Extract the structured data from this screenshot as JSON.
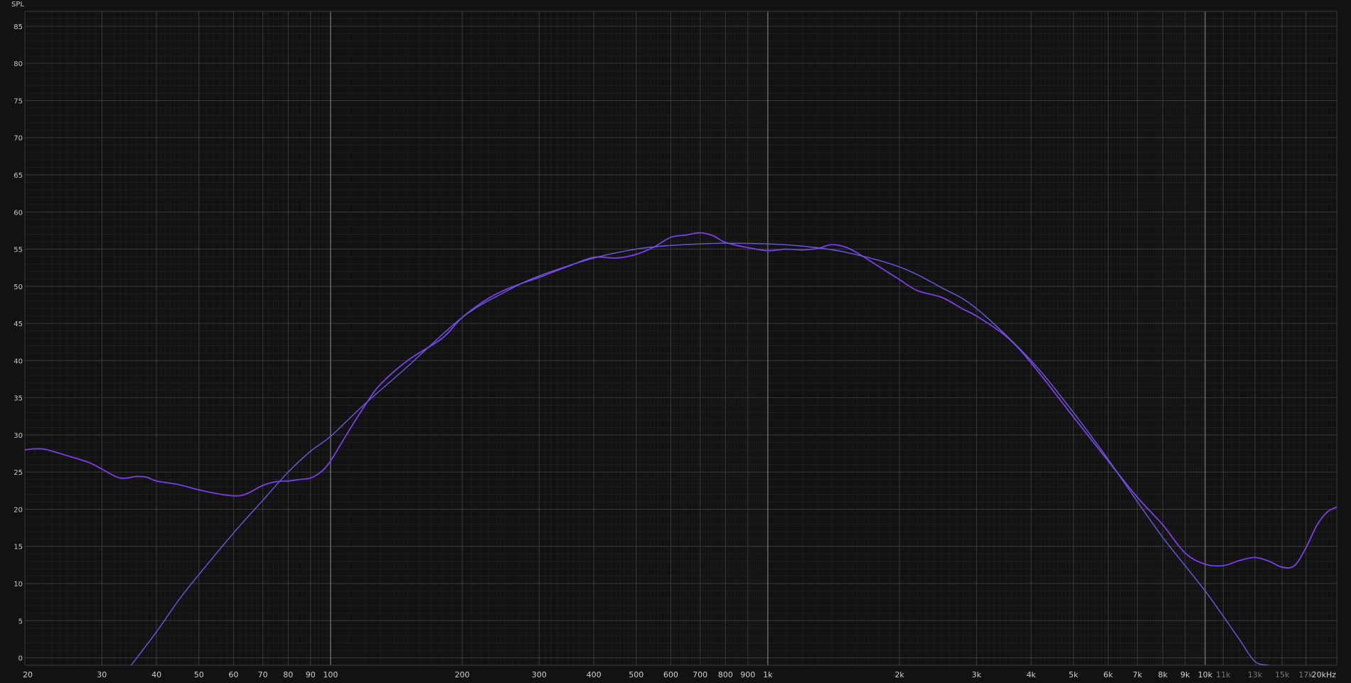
{
  "chart_data": {
    "type": "line",
    "title": "",
    "ylabel": "SPL",
    "xlabel": "",
    "x_scale": "log",
    "xlim": [
      20,
      20000
    ],
    "ylim": [
      -1,
      87
    ],
    "grid": true,
    "y_ticks": [
      {
        "value": 0,
        "label": "0"
      },
      {
        "value": 5,
        "label": "5"
      },
      {
        "value": 10,
        "label": "10"
      },
      {
        "value": 15,
        "label": "15"
      },
      {
        "value": 20,
        "label": "20"
      },
      {
        "value": 25,
        "label": "25"
      },
      {
        "value": 30,
        "label": "30"
      },
      {
        "value": 35,
        "label": "35"
      },
      {
        "value": 40,
        "label": "40"
      },
      {
        "value": 45,
        "label": "45"
      },
      {
        "value": 50,
        "label": "50"
      },
      {
        "value": 55,
        "label": "55"
      },
      {
        "value": 60,
        "label": "60"
      },
      {
        "value": 65,
        "label": "65"
      },
      {
        "value": 70,
        "label": "70"
      },
      {
        "value": 75,
        "label": "75"
      },
      {
        "value": 80,
        "label": "80"
      },
      {
        "value": 85,
        "label": "85"
      }
    ],
    "x_ticks": [
      {
        "value": 20,
        "label": "20",
        "minor": false
      },
      {
        "value": 30,
        "label": "30",
        "minor": false
      },
      {
        "value": 40,
        "label": "40",
        "minor": false
      },
      {
        "value": 50,
        "label": "50",
        "minor": false
      },
      {
        "value": 60,
        "label": "60",
        "minor": false
      },
      {
        "value": 70,
        "label": "70",
        "minor": false
      },
      {
        "value": 80,
        "label": "80",
        "minor": false
      },
      {
        "value": 90,
        "label": "90",
        "minor": false
      },
      {
        "value": 100,
        "label": "100",
        "minor": false
      },
      {
        "value": 200,
        "label": "200",
        "minor": false
      },
      {
        "value": 300,
        "label": "300",
        "minor": false
      },
      {
        "value": 400,
        "label": "400",
        "minor": false
      },
      {
        "value": 500,
        "label": "500",
        "minor": false
      },
      {
        "value": 600,
        "label": "600",
        "minor": false
      },
      {
        "value": 700,
        "label": "700",
        "minor": false
      },
      {
        "value": 800,
        "label": "800",
        "minor": false
      },
      {
        "value": 900,
        "label": "900",
        "minor": false
      },
      {
        "value": 1000,
        "label": "1k",
        "minor": false
      },
      {
        "value": 2000,
        "label": "2k",
        "minor": false
      },
      {
        "value": 3000,
        "label": "3k",
        "minor": false
      },
      {
        "value": 4000,
        "label": "4k",
        "minor": false
      },
      {
        "value": 5000,
        "label": "5k",
        "minor": false
      },
      {
        "value": 6000,
        "label": "6k",
        "minor": false
      },
      {
        "value": 7000,
        "label": "7k",
        "minor": false
      },
      {
        "value": 8000,
        "label": "8k",
        "minor": false
      },
      {
        "value": 9000,
        "label": "9k",
        "minor": false
      },
      {
        "value": 10000,
        "label": "10k",
        "minor": false
      },
      {
        "value": 11000,
        "label": "11k",
        "minor": true
      },
      {
        "value": 13000,
        "label": "13k",
        "minor": true
      },
      {
        "value": 15000,
        "label": "15k",
        "minor": true
      },
      {
        "value": 17000,
        "label": "17k",
        "minor": true
      },
      {
        "value": 20000,
        "label": "20kHz",
        "minor": false
      }
    ],
    "decade_lines": [
      100,
      1000,
      10000
    ],
    "series": [
      {
        "color": "#7b3fe8",
        "x": [
          20,
          22,
          25,
          28,
          30,
          33,
          36,
          38,
          40,
          45,
          50,
          55,
          60,
          63,
          66,
          70,
          75,
          80,
          85,
          90,
          95,
          100,
          110,
          120,
          130,
          150,
          180,
          200,
          230,
          260,
          300,
          350,
          400,
          450,
          500,
          550,
          600,
          650,
          700,
          750,
          800,
          900,
          1000,
          1100,
          1200,
          1300,
          1400,
          1500,
          1600,
          1800,
          2000,
          2200,
          2500,
          2800,
          3000,
          3500,
          4000,
          5000,
          6000,
          7000,
          8000,
          9000,
          10000,
          11000,
          12000,
          13000,
          14000,
          15000,
          16000,
          17000,
          18000,
          19000,
          20000
        ],
        "y": [
          28.0,
          28.1,
          27.2,
          26.3,
          25.4,
          24.2,
          24.4,
          24.3,
          23.8,
          23.3,
          22.6,
          22.1,
          21.8,
          21.9,
          22.4,
          23.2,
          23.7,
          23.8,
          24.0,
          24.2,
          25.0,
          26.5,
          30.5,
          34.0,
          36.8,
          40.0,
          43.0,
          45.8,
          48.4,
          49.9,
          51.2,
          52.7,
          53.9,
          53.8,
          54.3,
          55.3,
          56.6,
          56.9,
          57.2,
          56.8,
          55.9,
          55.2,
          54.8,
          55.0,
          54.9,
          55.1,
          55.6,
          55.3,
          54.5,
          52.6,
          50.9,
          49.4,
          48.5,
          46.9,
          46.0,
          43.3,
          39.7,
          32.4,
          26.5,
          21.6,
          17.9,
          14.1,
          12.6,
          12.4,
          13.1,
          13.5,
          13.0,
          12.2,
          12.4,
          14.8,
          17.8,
          19.6,
          20.3
        ]
      },
      {
        "color": "#6a5ae0",
        "x": [
          35,
          40,
          45,
          50,
          60,
          70,
          80,
          90,
          100,
          120,
          150,
          200,
          250,
          300,
          400,
          500,
          600,
          700,
          800,
          1000,
          1200,
          1500,
          2000,
          2500,
          3000,
          4000,
          5000,
          6000,
          7000,
          8000,
          9000,
          10000,
          11000,
          12000,
          13000,
          14000
        ],
        "y": [
          -1.0,
          3.5,
          7.8,
          11.2,
          16.8,
          21.2,
          25.0,
          27.8,
          29.8,
          34.2,
          39.2,
          45.8,
          49.2,
          51.4,
          53.8,
          55.0,
          55.5,
          55.7,
          55.8,
          55.7,
          55.4,
          54.6,
          52.6,
          49.8,
          47.0,
          40.0,
          33.0,
          26.7,
          21.0,
          16.2,
          12.4,
          9.0,
          5.6,
          2.4,
          -0.5,
          -1.0
        ]
      }
    ]
  }
}
